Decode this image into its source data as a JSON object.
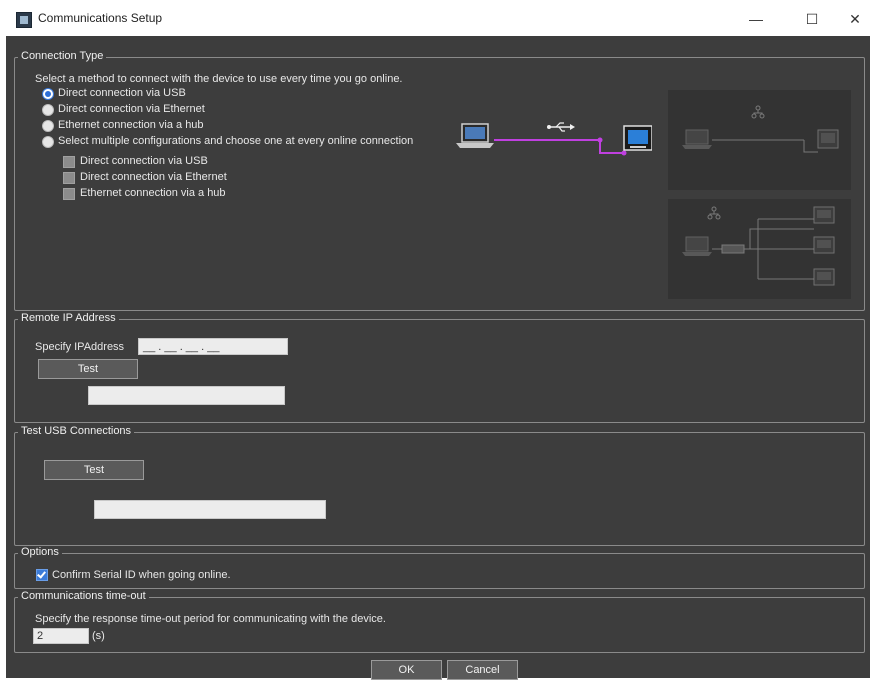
{
  "window": {
    "title": "Communications Setup",
    "minimize": "—",
    "maximize": "☐",
    "close": "✕"
  },
  "connection_type": {
    "legend": "Connection Type",
    "instruction": "Select a method to connect with the device to use every time you go online.",
    "options": [
      {
        "label": "Direct connection via USB",
        "selected": true
      },
      {
        "label": "Direct connection via Ethernet",
        "selected": false
      },
      {
        "label": "Ethernet connection via a hub",
        "selected": false
      },
      {
        "label": "Select multiple configurations and choose one at every online connection",
        "selected": false
      }
    ],
    "sub_options": [
      {
        "label": "Direct connection via USB",
        "checked": false
      },
      {
        "label": "Direct connection via Ethernet",
        "checked": false
      },
      {
        "label": "Ethernet connection via a hub",
        "checked": false
      }
    ],
    "usb_symbol": "⭠"
  },
  "remote_ip": {
    "legend": "Remote IP Address",
    "specify_label": "Specify IPAddress",
    "ip_value": "__ . __ . __ . __",
    "test_label": "Test",
    "result": ""
  },
  "test_usb": {
    "legend": "Test USB Connections",
    "test_label": "Test",
    "result": ""
  },
  "options": {
    "legend": "Options",
    "confirm_serial_label": "Confirm Serial ID when going online.",
    "confirm_serial_checked": true
  },
  "timeout": {
    "legend": "Communications time-out",
    "instruction": "Specify the response time-out period for communicating with the device.",
    "value": "2",
    "unit": "(s)"
  },
  "footer": {
    "ok_label": "OK",
    "cancel_label": "Cancel"
  },
  "colors": {
    "background": "#3d3d3d",
    "accent": "#2e6fd6",
    "usb_line": "#c040e0"
  }
}
